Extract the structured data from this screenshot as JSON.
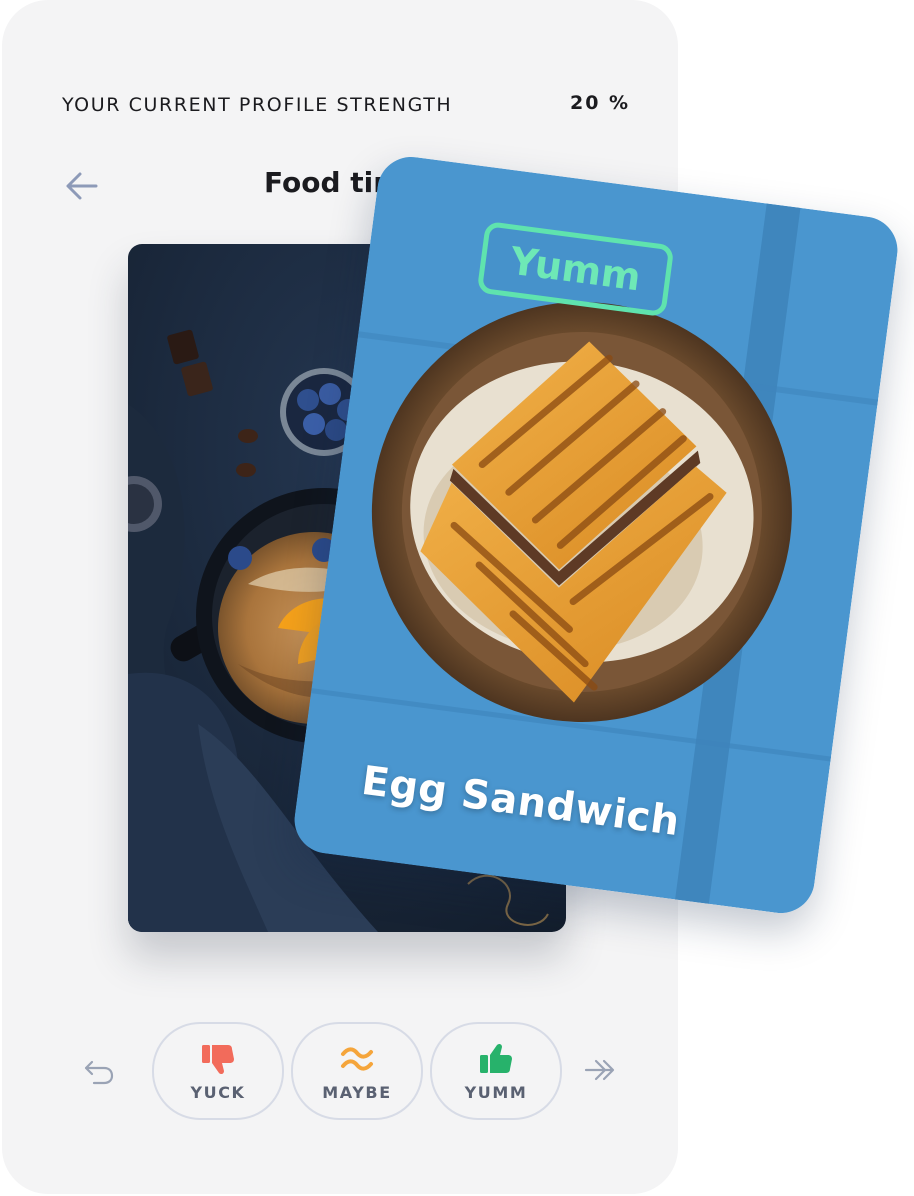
{
  "header": {
    "profile_strength_label": "YOUR CURRENT PROFILE STRENGTH",
    "profile_strength_value": "20 %"
  },
  "nav": {
    "back_icon": "arrow-left-icon",
    "title": "Food tinder"
  },
  "cards": {
    "back_card": {
      "image": "pancake-with-blueberries-photo"
    },
    "front_card": {
      "image": "grilled-sandwich-photo",
      "stamp": "Yumm",
      "name": "Egg Sandwich"
    }
  },
  "actions": {
    "undo_icon": "undo-icon",
    "skip_icon": "double-chevron-right-icon",
    "yuck": {
      "label": "YUCK",
      "icon": "thumbs-down-icon",
      "color": "#f26b5b"
    },
    "maybe": {
      "label": "MAYBE",
      "icon": "wavy-lines-icon",
      "color": "#f5a53b"
    },
    "yumm": {
      "label": "YUMM",
      "icon": "thumbs-up-icon",
      "color": "#27b26b"
    }
  },
  "colors": {
    "background": "#f4f4f5",
    "stamp_green": "#5fe3ae",
    "card_blue": "#4a96cf"
  }
}
